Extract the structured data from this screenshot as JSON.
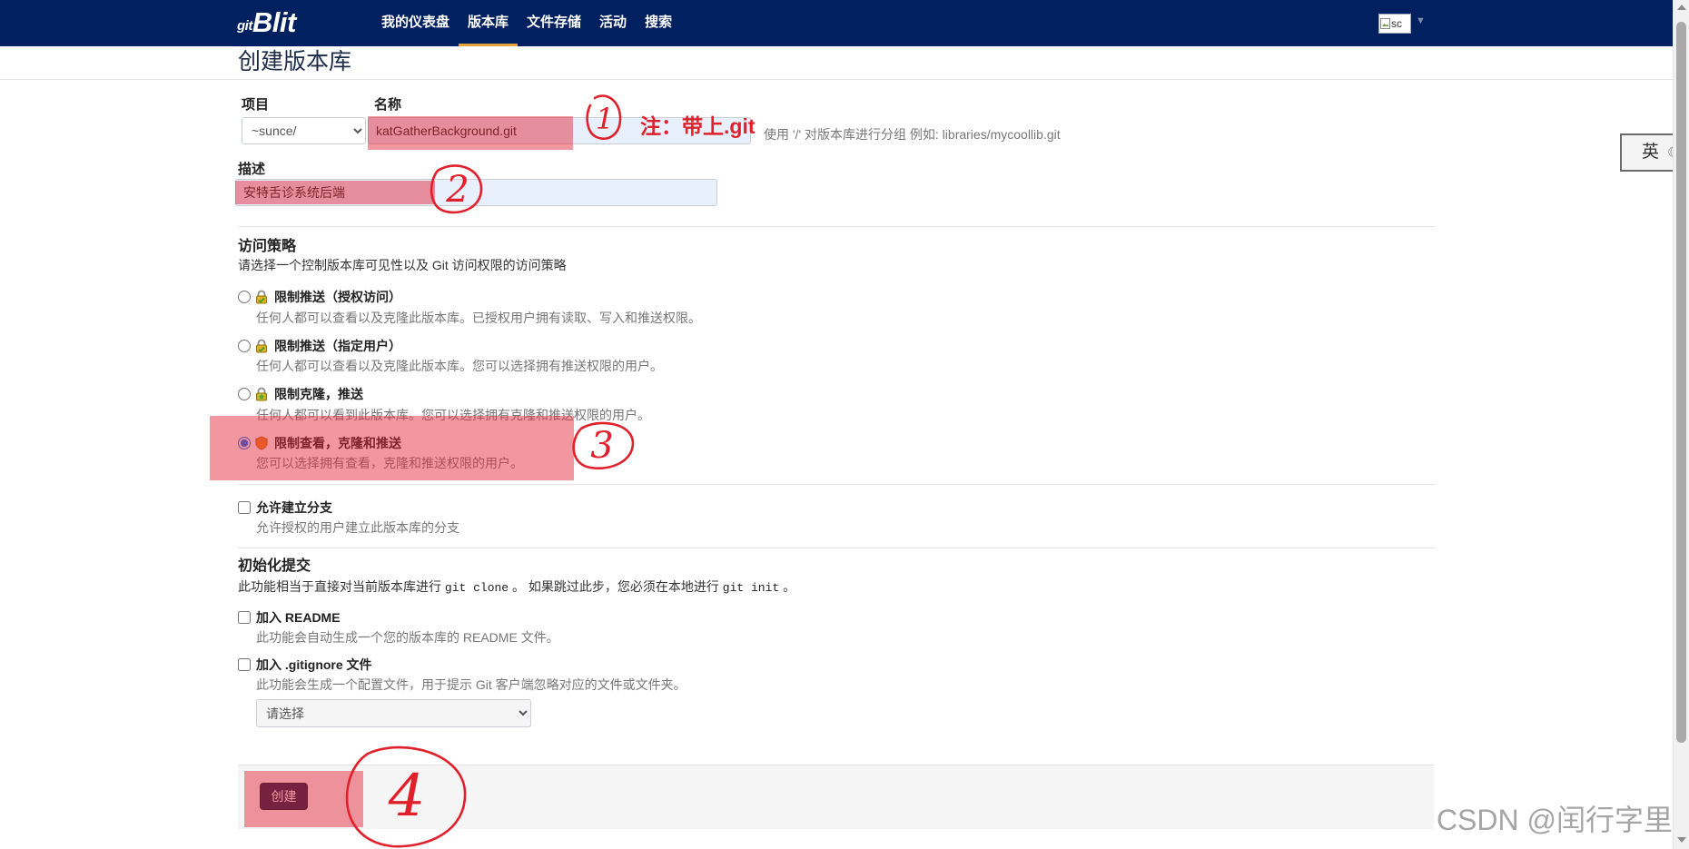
{
  "theme": {
    "nav_background": "#002060",
    "nav_active_underline": "#e8a33a",
    "annotation_color": "#e0202a",
    "button_background": "#13204a"
  },
  "navbar": {
    "logo": {
      "prefix": "git",
      "name": "Blit"
    },
    "items": [
      {
        "label": "我的仪表盘",
        "active": false
      },
      {
        "label": "版本库",
        "active": true
      },
      {
        "label": "文件存储",
        "active": false
      },
      {
        "label": "活动",
        "active": false
      },
      {
        "label": "搜索",
        "active": false
      }
    ],
    "user_avatar_alt": "sc",
    "user_menu_icon": "caret-down-icon"
  },
  "page": {
    "title": "创建版本库"
  },
  "form": {
    "project": {
      "label": "项目",
      "value": "~sunce/"
    },
    "name": {
      "label": "名称",
      "value": "katGatherBackground.git",
      "hint": "使用 '/' 对版本库进行分组 例如:  libraries/mycoollib.git"
    },
    "description": {
      "label": "描述",
      "value": "安特舌诊系统后端"
    },
    "access_policy": {
      "heading": "访问策略",
      "subheading": "请选择一个控制版本库可见性以及 Git 访问权限的访问策略",
      "options": [
        {
          "label": "限制推送（授权访问）",
          "description": "任何人都可以查看以及克隆此版本库。已授权用户拥有读取、写入和推送权限。",
          "icon": "lock-icon",
          "checked": false
        },
        {
          "label": "限制推送（指定用户）",
          "description": "任何人都可以查看以及克隆此版本库。您可以选择拥有推送权限的用户。",
          "icon": "lock-icon",
          "checked": false
        },
        {
          "label": "限制克隆，推送",
          "description": "任何人都可以看到此版本库。您可以选择拥有克隆和推送权限的用户。",
          "icon": "lock-icon",
          "checked": false
        },
        {
          "label": "限制查看，克隆和推送",
          "description": "您可以选择拥有查看，克隆和推送权限的用户。",
          "icon": "shield-icon",
          "checked": true
        }
      ]
    },
    "allow_forks": {
      "label": "允许建立分支",
      "description": "允许授权的用户建立此版本库的分支",
      "checked": false
    },
    "initial_commit": {
      "heading": "初始化提交",
      "description_parts": [
        "此功能相当于直接对当前版本库进行 ",
        "git clone",
        " 。 如果跳过此步，您必须在本地进行 ",
        "git init",
        " 。"
      ],
      "readme": {
        "label": "加入 README",
        "description": "此功能会自动生成一个您的版本库的 README 文件。",
        "checked": false
      },
      "gitignore": {
        "label": "加入 .gitignore 文件",
        "description": "此功能会生成一个配置文件，用于提示 Git 客户端忽略对应的文件或文件夹。",
        "checked": false,
        "select_value": "请选择"
      }
    },
    "submit_label": "创建"
  },
  "annotations": {
    "note": "注：带上.git",
    "marks": [
      "1",
      "2",
      "3",
      "4"
    ]
  },
  "ime_indicator": {
    "label": "英",
    "icon": "moon-icon"
  },
  "watermark": "CSDN @闰行字里"
}
